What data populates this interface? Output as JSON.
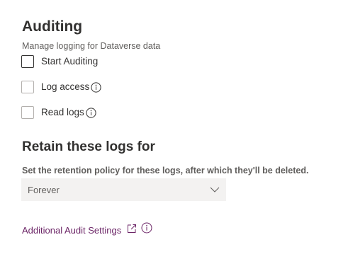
{
  "auditing": {
    "title": "Auditing",
    "description": "Manage logging for Dataverse data",
    "options": [
      {
        "label": "Start Auditing",
        "checked": false,
        "has_info": false
      },
      {
        "label": "Log access",
        "checked": false,
        "has_info": true
      },
      {
        "label": "Read logs",
        "checked": false,
        "has_info": true
      }
    ]
  },
  "retention": {
    "title": "Retain these logs for",
    "description": "Set the retention policy for these logs, after which they'll be deleted.",
    "selected": "Forever"
  },
  "additional": {
    "link_label": "Additional Audit Settings"
  },
  "colors": {
    "link": "#6b2466",
    "text": "#323130",
    "secondary_text": "#605e5c",
    "dropdown_bg": "#f3f2f1",
    "checkbox_border": "#b3b0ad"
  },
  "icons": {
    "info": "info-icon",
    "external": "open-in-new-window-icon",
    "dropdown": "chevron-down-icon"
  }
}
